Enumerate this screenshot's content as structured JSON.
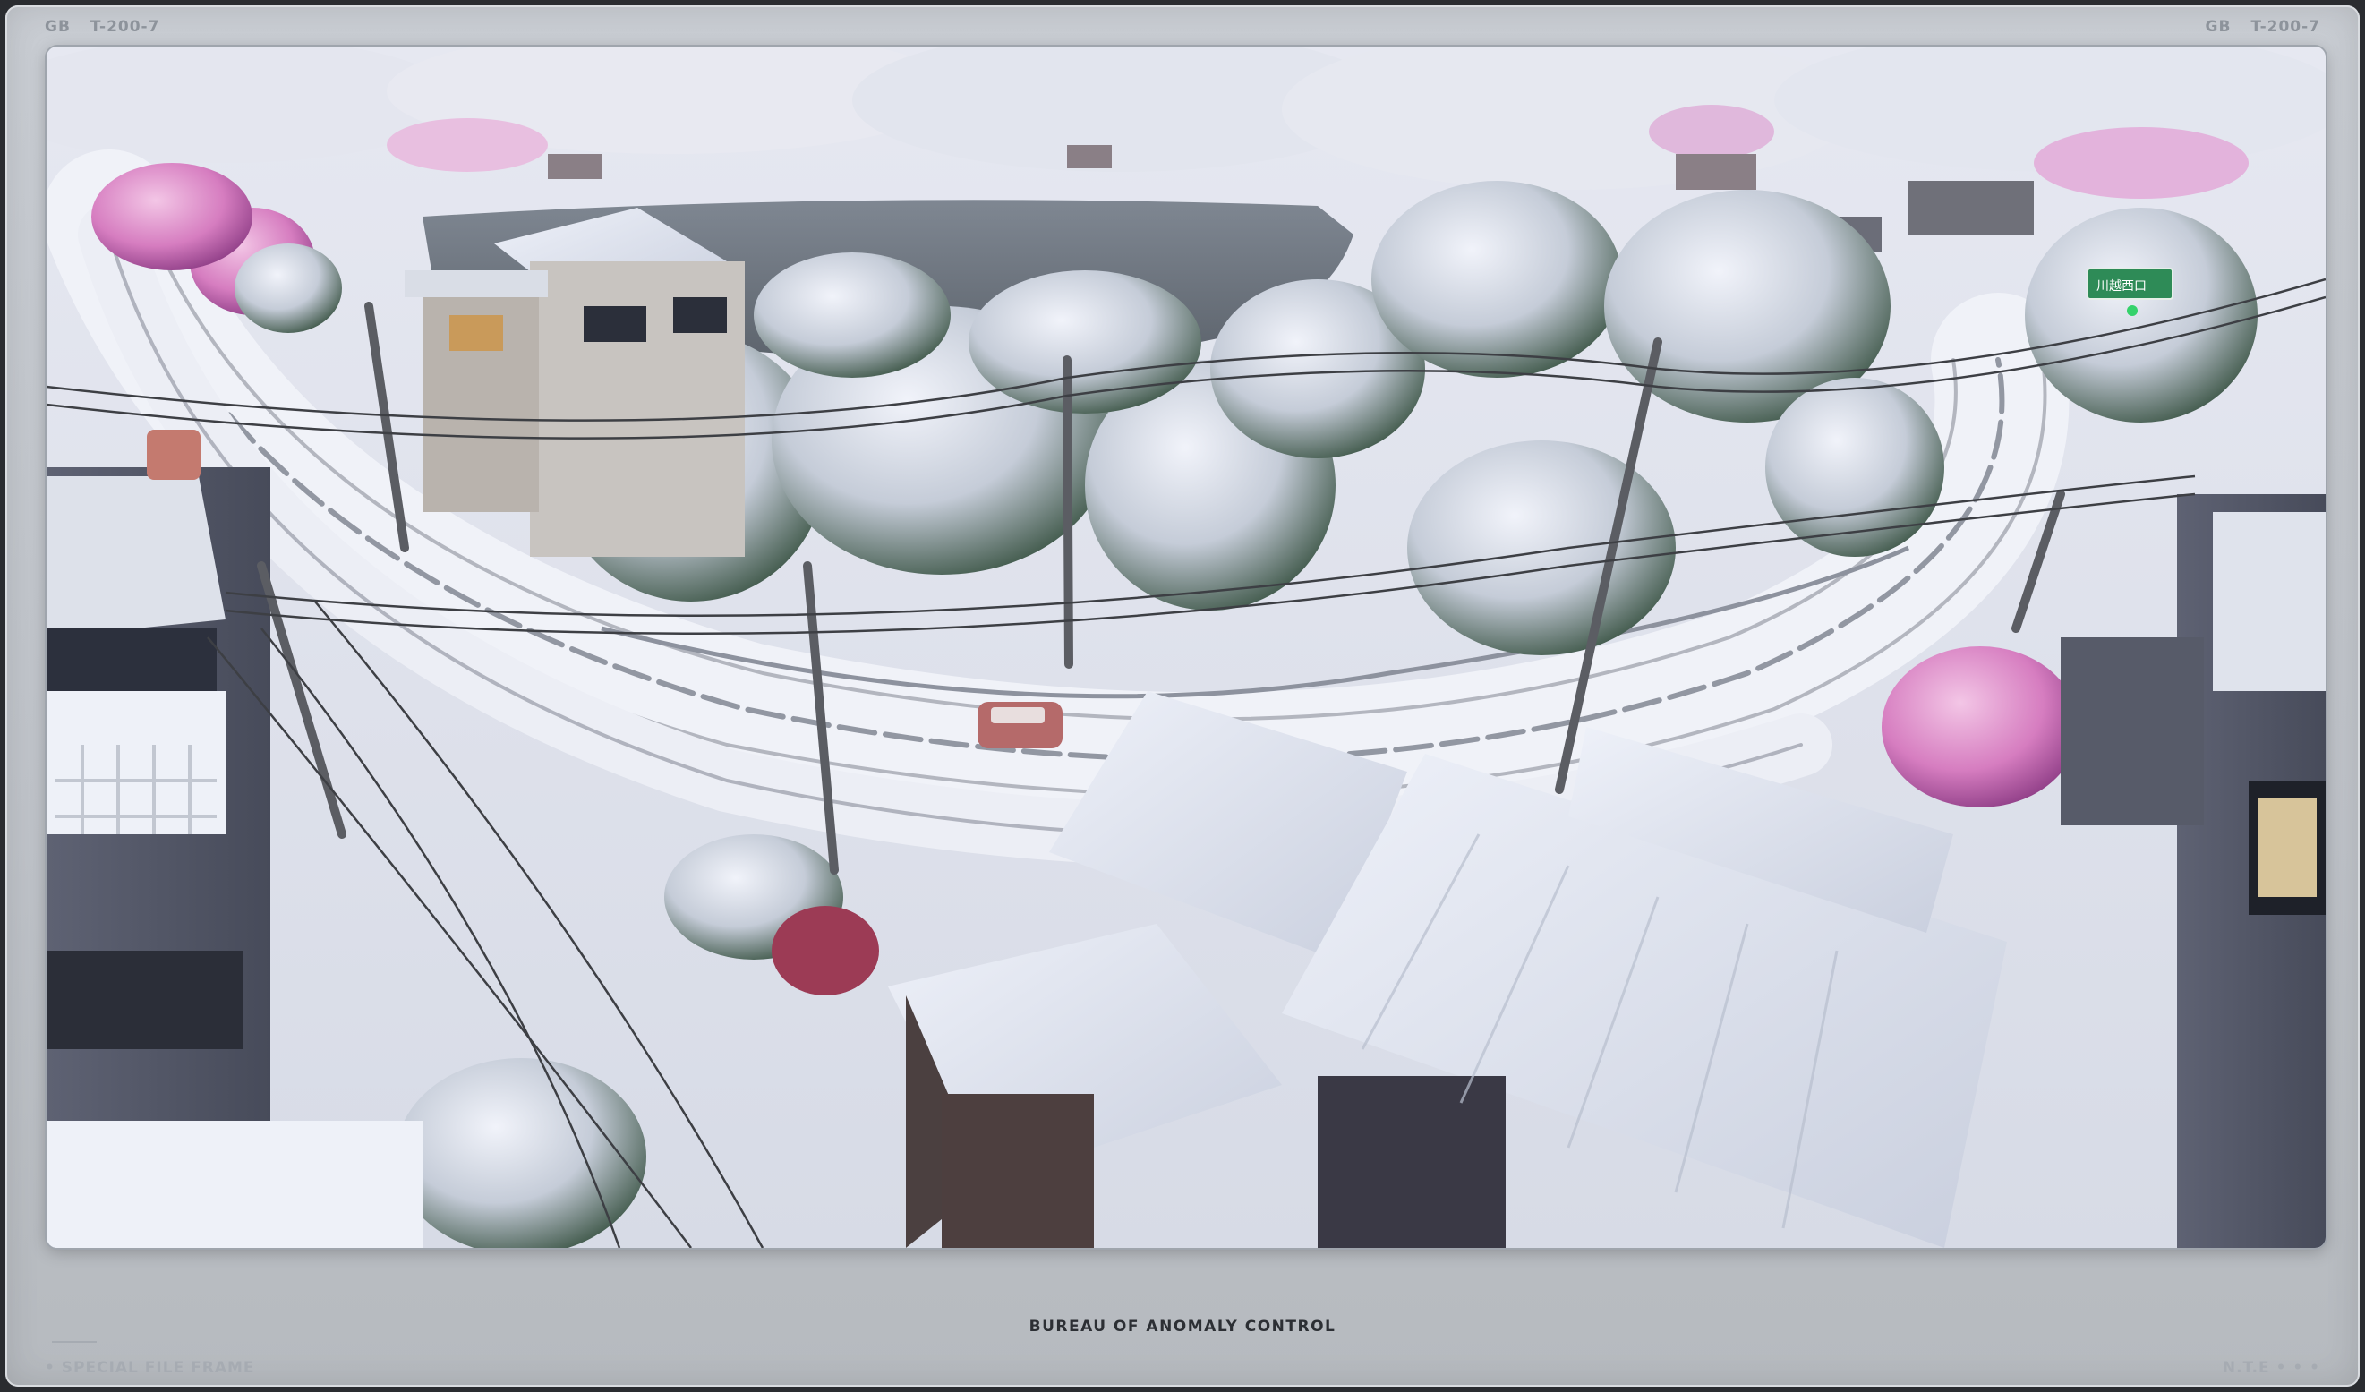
{
  "corner_tags": {
    "left": {
      "code": "GB",
      "serial": "T-200-7"
    },
    "right": {
      "code": "GB",
      "serial": "T-200-7"
    }
  },
  "road_sign": {
    "text": "川越西口",
    "color": "#2e8b57"
  },
  "footer": {
    "title": "BUREAU OF ANOMALY CONTROL",
    "left_label": "• SPECIAL FILE FRAME",
    "right_label": "N.T.E • • •"
  },
  "colors": {
    "frame": "#c4c8ce",
    "snow": "#eef1f8",
    "water": "#6e7680",
    "blossom": "#d77bc0",
    "foliage": "#3f5a4a"
  }
}
